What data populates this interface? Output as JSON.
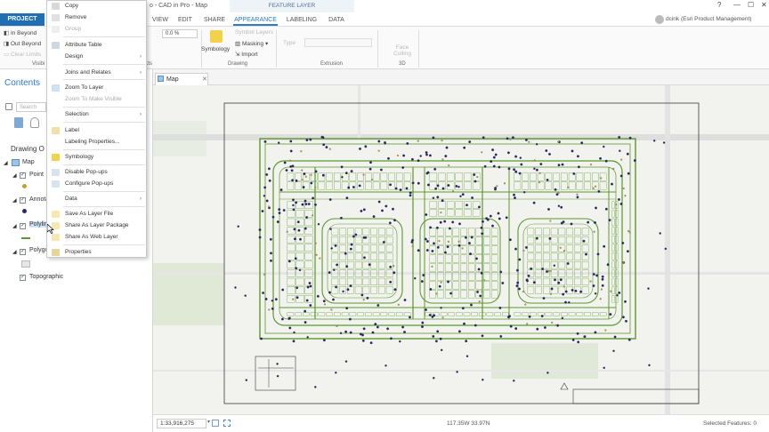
{
  "app": {
    "title": "o - CAD in Pro - Map",
    "feature_layer_header": "FEATURE LAYER",
    "help": "?",
    "minimize": "—",
    "maximize": "☐",
    "close": "✕",
    "user": "dcink (Esri Product Management)"
  },
  "tabs": {
    "project": "PROJECT",
    "view": "VIEW",
    "edit": "EDIT",
    "share": "SHARE",
    "appearance": "APPEARANCE",
    "labeling": "LABELING",
    "data": "DATA"
  },
  "ribbon": {
    "in_beyond": "In Beyond",
    "out_beyond": "Out Beyond",
    "clear_limits": "Clear Limits",
    "visibility_group": "Visibi",
    "effects_group": "ects",
    "transparency_value": "0.0 %",
    "symbology": "Symbology",
    "symbol_layers": "Symbol Layers",
    "masking": "Masking",
    "import": "Import",
    "drawing_group": "Drawing",
    "type": "Type",
    "extrusion_group": "Extrusion",
    "face_culling": "Face Culling",
    "threed_group": "3D"
  },
  "contents": {
    "title": "Contents",
    "search_placeholder": "Search",
    "drawing_order": "Drawing O",
    "map": "Map",
    "point": "Point",
    "annotation": "Annota",
    "polyline": "Polylin",
    "polygon": "Polygo",
    "topographic": "Topographic"
  },
  "context_menu": {
    "copy": "Copy",
    "remove": "Remove",
    "group": "Group",
    "attribute_table": "Attribute Table",
    "design": "Design",
    "joins_relates": "Joins and Relates",
    "zoom_to_layer": "Zoom To Layer",
    "zoom_visible": "Zoom To Make Visible",
    "selection": "Selection",
    "label": "Label",
    "labeling_properties": "Labeling Properties...",
    "symbology": "Symbology",
    "disable_popups": "Disable Pop-ups",
    "configure_popups": "Configure Pop-ups",
    "data": "Data",
    "save_layer_file": "Save As Layer File",
    "share_layer_package": "Share As Layer Package",
    "share_web_layer": "Share As Web Layer",
    "properties": "Properties"
  },
  "map": {
    "tab_label": "Map",
    "scale": "1:33,916,275",
    "coordinates": "117.35W 33.97N",
    "selected_features": "Selected Features: 0"
  },
  "colors": {
    "accent": "#1f6fb5",
    "cad_green": "#5a9a2a",
    "point_navy": "#1f1f6e"
  }
}
